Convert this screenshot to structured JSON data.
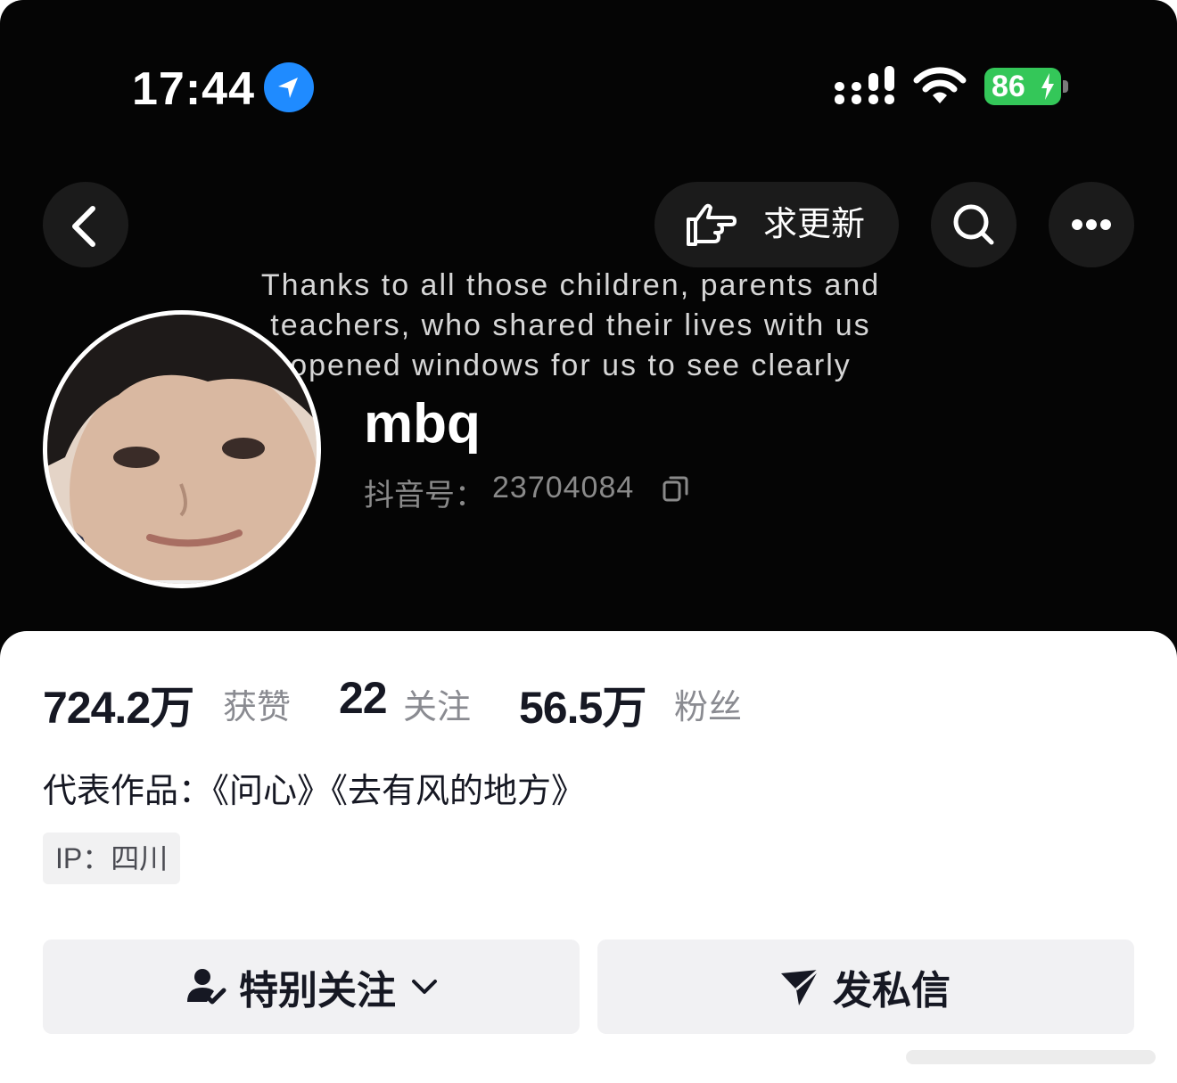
{
  "status_bar": {
    "time": "17:44",
    "battery": "86"
  },
  "nav": {
    "update_button": "求更新",
    "back_icon": "chevron-left-icon",
    "search_icon": "search-icon",
    "more_icon": "more-dots-icon"
  },
  "banner_caption": "Thanks to all those children, parents and teachers, who shared their lives with us opened windows for us to see clearly",
  "profile": {
    "username": "mbq",
    "id_label": "抖音号：",
    "id_value": "23704084"
  },
  "stats": [
    {
      "value": "724.2万",
      "label": "获赞"
    },
    {
      "value": "22",
      "label": "关注"
    },
    {
      "value": "56.5万",
      "label": "粉丝"
    }
  ],
  "bio": "代表作品：《问心》《去有风的地方》",
  "ip_location": "IP：四川",
  "actions": {
    "follow_label": "特别关注",
    "message_label": "发私信"
  },
  "colors": {
    "header_bg": "#050505",
    "battery_green": "#34c759",
    "location_blue": "#1f8bff",
    "button_bg": "#f1f1f3",
    "text_primary": "#161823",
    "text_secondary": "#8a8b91"
  }
}
